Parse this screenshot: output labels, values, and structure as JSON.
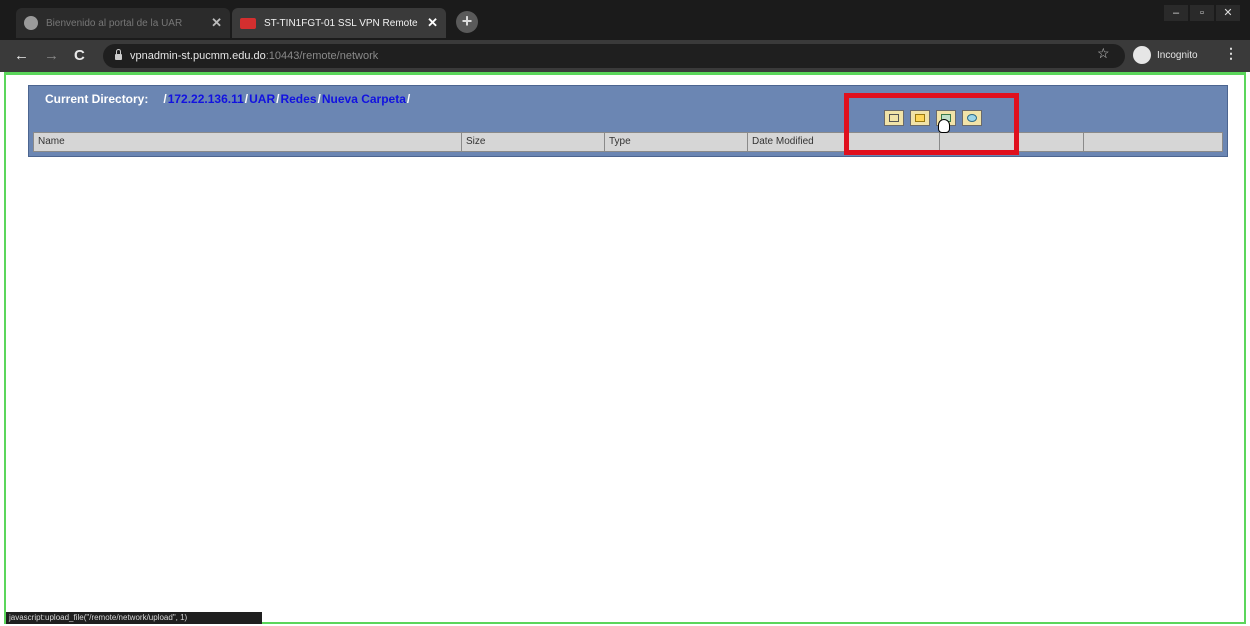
{
  "browser": {
    "tabs": [
      {
        "title": "Bienvenido al portal de la UAR",
        "active": false
      },
      {
        "title": "ST-TIN1FGT-01 SSL VPN Remote",
        "active": true
      }
    ],
    "new_tab": "+",
    "window_controls": [
      "–",
      "▫",
      "✕"
    ],
    "url_host": "vpnadmin-st.pucmm.edu.do",
    "url_rest": ":10443/remote/network",
    "profile_label": "Incognito",
    "menu": "⋮"
  },
  "page": {
    "current_directory_label": "Current Directory:",
    "breadcrumbs": [
      "172.22.136.11",
      "UAR",
      "Redes",
      "Nueva Carpeta"
    ],
    "table_headers": [
      "Name",
      "Size",
      "Type",
      "Date Modified",
      "",
      ""
    ],
    "toolbar_icons": [
      "new-file-icon",
      "new-folder-icon",
      "upload-icon",
      "refresh-icon"
    ]
  },
  "statusbar": {
    "text": "javascript:upload_file(\"/remote/network/upload\", 1)"
  },
  "colors": {
    "panel": "#6b86b3",
    "link": "#1212e0",
    "highlight": "#e0101e",
    "frame": "#5bd65b"
  }
}
